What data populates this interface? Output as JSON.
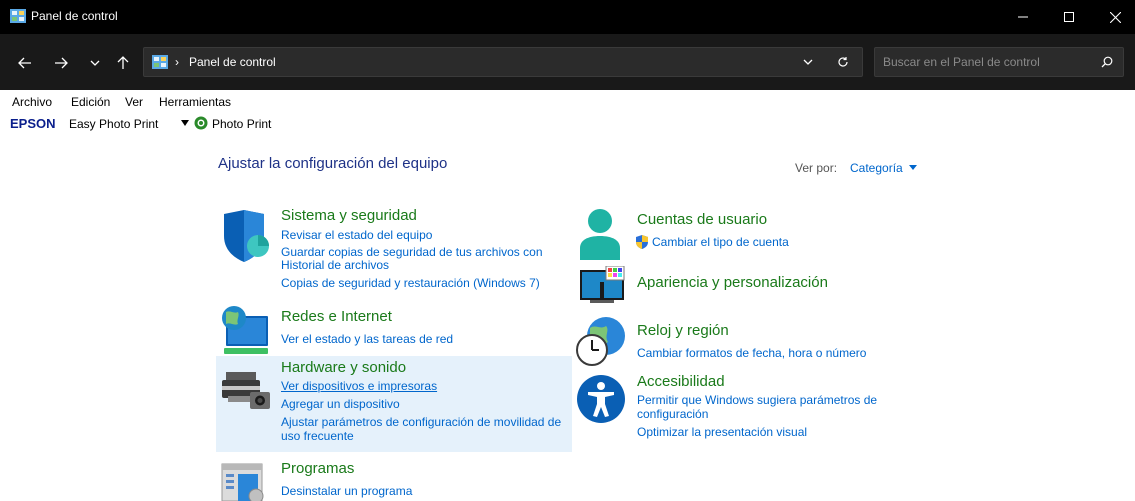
{
  "window": {
    "title": "Panel de control"
  },
  "nav": {
    "address": "Panel de control",
    "search_placeholder": "Buscar en el Panel de control"
  },
  "menu": [
    "Archivo",
    "Edición",
    "Ver",
    "Herramientas"
  ],
  "epson": {
    "logo": "EPSON",
    "easy_photo_print": "Easy Photo Print",
    "photo_print": "Photo Print"
  },
  "main": {
    "title": "Ajustar la configuración del equipo",
    "view_by_label": "Ver por:",
    "view_by_value": "Categoría"
  },
  "categories": {
    "sistema": {
      "title": "Sistema y seguridad",
      "links": [
        "Revisar el estado del equipo",
        "Guardar copias de seguridad de tus archivos con",
        "Historial de archivos",
        "Copias de seguridad y restauración (Windows 7)"
      ]
    },
    "redes": {
      "title": "Redes e Internet",
      "links": [
        "Ver el estado y las tareas de red"
      ]
    },
    "hardware": {
      "title": "Hardware y sonido",
      "links": [
        "Ver dispositivos e impresoras",
        "Agregar un dispositivo",
        "Ajustar parámetros de configuración de movilidad de",
        "uso frecuente"
      ]
    },
    "programas": {
      "title": "Programas",
      "links": [
        "Desinstalar un programa"
      ]
    },
    "cuentas": {
      "title": "Cuentas de usuario",
      "links": [
        "Cambiar el tipo de cuenta"
      ]
    },
    "apariencia": {
      "title": "Apariencia y personalización"
    },
    "reloj": {
      "title": "Reloj y región",
      "links": [
        "Cambiar formatos de fecha, hora o número"
      ]
    },
    "accesibilidad": {
      "title": "Accesibilidad",
      "links": [
        "Permitir que Windows sugiera parámetros de",
        "configuración",
        "Optimizar la presentación visual"
      ]
    }
  },
  "colors": {
    "title_bar": "#000000",
    "nav_bar": "#191919",
    "category_title": "#1a7a1a",
    "link": "#0066cc",
    "page_title": "#1e3287",
    "hover_background": "#e5f1fb"
  }
}
